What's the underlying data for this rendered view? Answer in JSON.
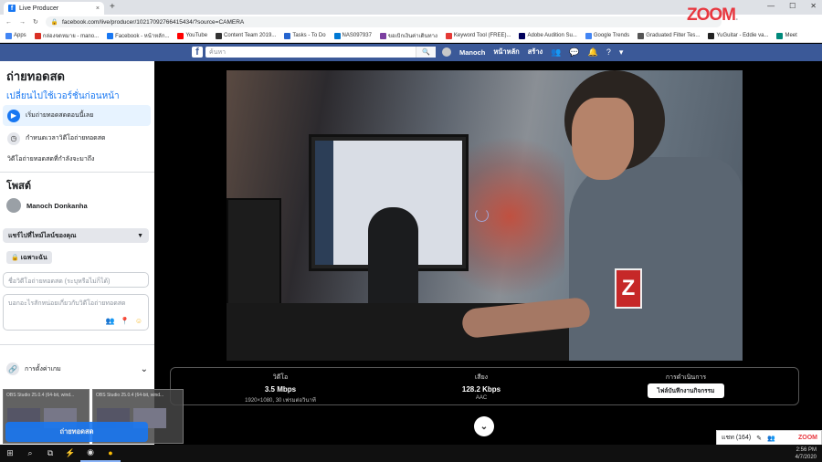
{
  "browser": {
    "tab_title": "Live Producer",
    "tab_close": "×",
    "new_tab": "+",
    "url": "facebook.com/live/producer/1021709276641543​4/?source=CAMERA",
    "nav_back": "←",
    "nav_forward": "→",
    "reload": "↻",
    "window_controls": [
      "—",
      "☐",
      "✕"
    ],
    "bookmarks": [
      {
        "label": "Apps",
        "color": "#4285f4"
      },
      {
        "label": "กล่องจดหมาย - mano...",
        "color": "#d93025"
      },
      {
        "label": "Facebook - หน้าหลัก...",
        "color": "#1877f2"
      },
      {
        "label": "YouTube",
        "color": "#ff0000"
      },
      {
        "label": "Content Team 2019...",
        "color": "#333333"
      },
      {
        "label": "Tasks - To Do",
        "color": "#2564cf"
      },
      {
        "label": "NAS097937",
        "color": "#0078d4"
      },
      {
        "label": "ขอเบิกเงินค่าเดินทาง",
        "color": "#7b3fa0"
      },
      {
        "label": "Keyword Tool (FREE)...",
        "color": "#e53935"
      },
      {
        "label": "Adobe Audition Su...",
        "color": "#00005b"
      },
      {
        "label": "Google Trends",
        "color": "#4285f4"
      },
      {
        "label": "Graduated Filter Tes...",
        "color": "#555555"
      },
      {
        "label": "YuGuitar - Eddie va...",
        "color": "#222222"
      },
      {
        "label": "Meet",
        "color": "#00897b"
      }
    ]
  },
  "watermark": {
    "brand": "ZOOM",
    "suffix": "."
  },
  "facebook_nav": {
    "logo": "f",
    "search_placeholder": "ค้นหา",
    "search_icon": "🔍",
    "user_name": "Manoch",
    "home": "หน้าหลัก",
    "create": "สร้าง",
    "icons": [
      "friends-icon",
      "messenger-icon",
      "notifications-icon",
      "help-icon",
      "dropdown-icon"
    ],
    "icon_glyphs": [
      "👥",
      "💬",
      "🔔",
      "?",
      "▾"
    ]
  },
  "left_panel": {
    "title": "ถ่ายทอดสด",
    "switch_to": "เปลี่ยนไปใช้เวอร์ชั่นก่อนหน้า",
    "options": [
      {
        "label": "เริ่มถ่ายทอดสดตอนนี้เลย",
        "selected": true,
        "icon": "live-camera-icon",
        "glyph": "▶"
      },
      {
        "label": "กำหนดเวลาวิดีโอถ่ายทอดสด",
        "selected": false,
        "icon": "clock-icon",
        "glyph": "◷"
      },
      {
        "label": "วิดีโอถ่ายทอดสดที่กำลังจะมาถึง",
        "selected": false,
        "icon": "",
        "glyph": ""
      }
    ],
    "post_heading": "โพสต์",
    "poster_name": "Manoch Donkanha",
    "share_select": "แชร์ไปที่ไทม์ไลน์ของคุณ",
    "share_caret": "▼",
    "privacy": "🔒 เฉพาะฉัน",
    "title_placeholder": "ชื่อวิดีโอถ่ายทอดสด (ระบุหรือไม่ก็ได้)",
    "desc_placeholder": "บอกอะไรสักหน่อยเกี่ยวกับวิดีโอถ่ายทอดสด",
    "settings_label": "การตั้งค่าเกม",
    "settings_caret": "⌄",
    "go_live_button": "ถ่ายทอดสด"
  },
  "stats": {
    "video": {
      "title": "วิดีโอ",
      "value": "3.5 Mbps",
      "sub": "1920×1080, 30 เฟรมต่อวินาที"
    },
    "audio": {
      "title": "เสียง",
      "value": "128.2 Kbps",
      "sub": "AAC"
    },
    "activity": {
      "title": "การดำเนินการ",
      "button": "ไฟล์บันทึกงานกิจกรรม"
    }
  },
  "down_button": "⌄",
  "chat": {
    "label": "แชท (164)",
    "brand": "ZOOM"
  },
  "obs_windows": [
    {
      "title": "OBS Studio 25.0.4 (64-bit, wind..."
    },
    {
      "title": "OBS Studio 25.0.4 (64-bit, wind..."
    }
  ],
  "taskbar": {
    "items": [
      "⊞",
      "⌕",
      "⧉",
      "⚡",
      "◉",
      "●"
    ],
    "time": "2:56 PM",
    "date": "4/7/2020"
  }
}
